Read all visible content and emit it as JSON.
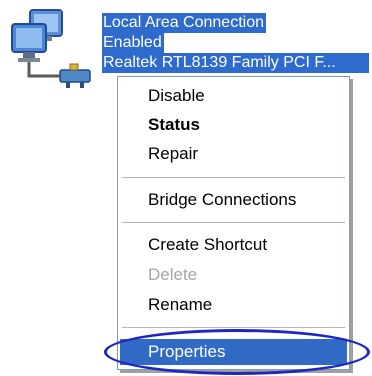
{
  "connection": {
    "name": "Local Area Connection",
    "status": "Enabled",
    "device": "Realtek RTL8139 Family PCI F..."
  },
  "context_menu": {
    "items": [
      {
        "label": "Disable",
        "style": "normal"
      },
      {
        "label": "Status",
        "style": "bold"
      },
      {
        "label": "Repair",
        "style": "normal"
      },
      {
        "label": "Bridge Connections",
        "style": "normal"
      },
      {
        "label": "Create Shortcut",
        "style": "normal"
      },
      {
        "label": "Delete",
        "style": "disabled"
      },
      {
        "label": "Rename",
        "style": "normal"
      },
      {
        "label": "Properties",
        "style": "selected"
      }
    ]
  },
  "icons": {
    "connection": "network-computers-icon"
  },
  "colors": {
    "selection_blue": "#316ac5",
    "label_highlight": "#2f6bcc",
    "annotation_ellipse": "#1f27c0",
    "disabled_text": "#a6a6a6"
  }
}
